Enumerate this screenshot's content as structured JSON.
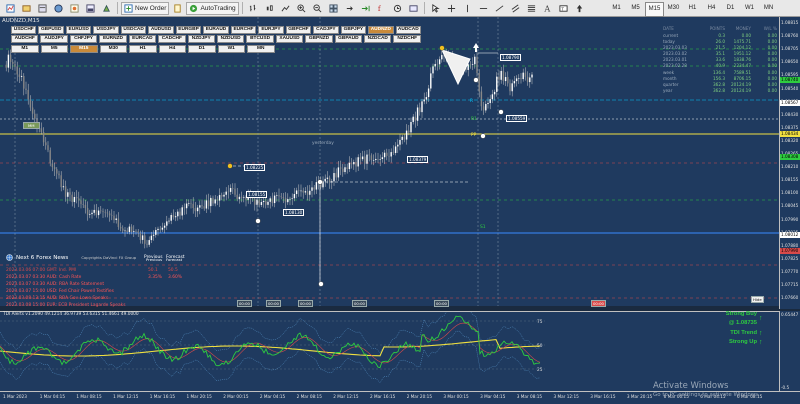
{
  "toolbar": {
    "new_order_label": "New Order",
    "autotrading_label": "AutoTrading",
    "timeframes": [
      "M1",
      "M5",
      "M15",
      "M30",
      "H1",
      "H4",
      "D1",
      "W1",
      "MN"
    ]
  },
  "chart": {
    "title": "AUDNZD,M15",
    "bg_color": "#1f3a5f",
    "price_axis": [
      "1.08815",
      "1.08760",
      "1.08705",
      "1.08650",
      "1.08595",
      "1.08540",
      "1.08485",
      "1.08430",
      "1.08375",
      "1.08320",
      "1.08265",
      "1.08210",
      "1.08155",
      "1.08100",
      "1.08045",
      "1.07990",
      "1.07935",
      "1.07880",
      "1.07825",
      "1.07770",
      "1.07715",
      "1.07660"
    ],
    "price_tags": [
      {
        "text": "1.08740",
        "color": "#2ecc40"
      },
      {
        "text": "1.08567",
        "color": "#ffffff"
      },
      {
        "text": "1.08434",
        "color": "#f0e040"
      },
      {
        "text": "1.08308",
        "color": "#2ecc40"
      },
      {
        "text": "1.08012",
        "color": "#ffffff"
      },
      {
        "text": "1.07990",
        "color": "#d84a4a"
      }
    ],
    "labels": {
      "yesterday": "yesterday",
      "previous": "Previous",
      "forecast": "Forecast",
      "mm": "MM",
      "r_label": "R",
      "s_label": "S",
      "r1": "R1",
      "s1": "S1",
      "pp": "PP"
    },
    "level_boxes": [
      "1.08790",
      "1.08559",
      "1.08379",
      "1.08225",
      "1.08155",
      "1.08130"
    ],
    "bottom_tags": [
      "00:00",
      "00:00",
      "00:00",
      "00:00",
      "00:00",
      "00:00"
    ]
  },
  "symbols": {
    "row1": [
      "USDCHF",
      "GBPUSD",
      "EURUSD",
      "USDJPY",
      "USDCAD",
      "AUDUSD",
      "EURGBP",
      "EURAUD",
      "EURCHF",
      "EURJPY",
      "GBPCHF",
      "CADJPY",
      "GBPJPY",
      "AUDNZD",
      "AUDCAD"
    ],
    "row2": [
      "AUDCHF",
      "AUDJPY",
      "CHFJPY",
      "EURNZD",
      "EURCAD",
      "CADCHF",
      "NZDJPY",
      "NZDUSD",
      "BTCUSD",
      "XAUUSD",
      "GBPNZD",
      "GBPAUD",
      "NZDCAD",
      "NZDCHF"
    ],
    "active": "AUDNZD",
    "timeframes": [
      "M1",
      "M5",
      "M15",
      "M30",
      "H1",
      "H4",
      "D1",
      "W1",
      "MN"
    ],
    "active_tf": "M15"
  },
  "stats": {
    "headers": [
      "DATE",
      "POINTS",
      "MONEY",
      "W/L %"
    ],
    "rows": [
      [
        "current",
        "0.3",
        "0.00",
        "0.00"
      ],
      [
        "today",
        "26.0",
        "1475.71",
        "0.00"
      ],
      [
        "2023.03.03",
        "21.5",
        "1204.12",
        "0.00"
      ],
      [
        "2023.03.02",
        "35.1",
        "1951.12",
        "0.00"
      ],
      [
        "2023.03.01",
        "33.6",
        "1838.76",
        "0.00"
      ],
      [
        "2023.02.28",
        "40.9",
        "2234.47",
        "0.00"
      ],
      [
        "week",
        "136.4",
        "7589.51",
        "0.00"
      ],
      [
        "month",
        "156.3",
        "8706.15",
        "0.00"
      ],
      [
        "quarter",
        "362.8",
        "20124.19",
        "0.00"
      ],
      [
        "year",
        "362.8",
        "20124.19",
        "0.00"
      ]
    ]
  },
  "news": {
    "title": "Next 6 Forex News",
    "brand": "Copyrights DaVinci FX Group",
    "col_previous": "Previous",
    "col_forecast": "Forecast",
    "items": [
      {
        "text": "2023.03.06 07:00  GMT: Ind. PMI",
        "prev": "50.1",
        "fcst": "50.5"
      },
      {
        "text": "2023.03.07 03:30  AUD: Cash Rate",
        "prev": "3.35%",
        "fcst": "3.60%"
      },
      {
        "text": "2023.03.07 03:30  AUD: RBA Rate Statement",
        "prev": "",
        "fcst": ""
      },
      {
        "text": "2023.03.07 15:00  USD: Fed Chair Powell Testifies",
        "prev": "",
        "fcst": ""
      },
      {
        "text": "2023.03.08 13:15  AUD: RBA Gov Lowe Speaks",
        "prev": "",
        "fcst": ""
      },
      {
        "text": "2023.03.08 15:00  EUR: ECB President Lagarde Speaks",
        "prev": "",
        "fcst": ""
      }
    ]
  },
  "indicator": {
    "title": "TDI Alerts v1.2090 49.1214 36.9739 53.6315 51.4661 49.0000",
    "axis": [
      "75",
      "50",
      "25"
    ],
    "signals": [
      "Strong Buy",
      "@ 1.08735",
      "TDI Trend",
      "Strong Up"
    ]
  },
  "time_axis": [
    "1 Mar 2023",
    "1 Mar 04:15",
    "1 Mar 08:15",
    "1 Mar 12:15",
    "1 Mar 16:15",
    "1 Mar 20:15",
    "2 Mar 00:15",
    "2 Mar 04:15",
    "2 Mar 08:15",
    "2 Mar 12:15",
    "2 Mar 16:15",
    "2 Mar 20:15",
    "3 Mar 00:15",
    "3 Mar 04:15",
    "3 Mar 08:15",
    "3 Mar 12:15",
    "3 Mar 16:15",
    "3 Mar 20:15",
    "6 Mar 00:15",
    "6 Mar 04:15",
    "6 Mar 08:15"
  ],
  "windows": {
    "activate": "Activate Windows",
    "activate_sub": "Go to PC settings to activate Windows."
  }
}
